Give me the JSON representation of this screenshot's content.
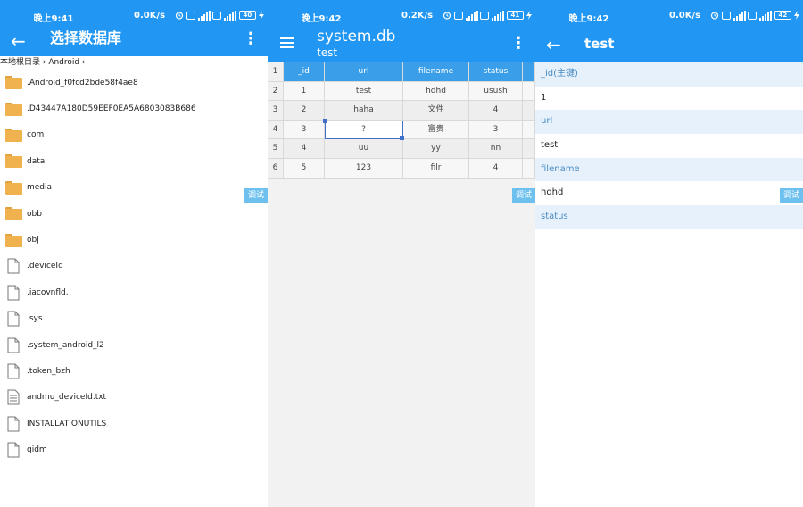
{
  "panels": [
    {
      "status": {
        "time": "晚上9:41",
        "net": "0.0K/s",
        "battery": "40"
      },
      "appbar": {
        "back": "←",
        "title": "选择数据库",
        "menu": "⋮"
      },
      "breadcrumb": "本地根目录 › Android ›",
      "files": [
        {
          "name": ".Android_f0fcd2bde58f4ae8",
          "icon": "folder-icon"
        },
        {
          "name": ".D43447A180D59EEF0EA5A6803083B686",
          "icon": "folder-icon"
        },
        {
          "name": "com",
          "icon": "folder-icon"
        },
        {
          "name": "data",
          "icon": "folder-icon"
        },
        {
          "name": "media",
          "icon": "folder-icon"
        },
        {
          "name": "obb",
          "icon": "folder-icon"
        },
        {
          "name": "obj",
          "icon": "folder-icon"
        },
        {
          "name": ".deviceId",
          "icon": "file-icon"
        },
        {
          "name": ".iacovnfld.",
          "icon": "file-icon"
        },
        {
          "name": ".sys",
          "icon": "file-icon"
        },
        {
          "name": ".system_android_l2",
          "icon": "file-icon"
        },
        {
          "name": ".token_bzh",
          "icon": "file-icon"
        },
        {
          "name": "andmu_deviceId.txt",
          "icon": "text-file-icon"
        },
        {
          "name": "INSTALLATIONUTILS",
          "icon": "file-icon"
        },
        {
          "name": "qidm",
          "icon": "file-icon"
        }
      ],
      "debug": "调试"
    },
    {
      "status": {
        "time": "晚上9:42",
        "net": "0.2K/s",
        "battery": "41"
      },
      "appbar": {
        "title": "system.db",
        "subtitle": "test",
        "menu": "⋮"
      },
      "table": {
        "rownums": [
          "1",
          "2",
          "3",
          "4",
          "5",
          "6"
        ],
        "columns": [
          "_id",
          "url",
          "filename",
          "status"
        ],
        "rows": [
          [
            "1",
            "test",
            "hdhd",
            "usush"
          ],
          [
            "2",
            "haha",
            "文件",
            "4"
          ],
          [
            "3",
            "?",
            "富贵",
            "3"
          ],
          [
            "4",
            "uu",
            "yy",
            "nn"
          ],
          [
            "5",
            "123",
            "filr",
            "4"
          ]
        ]
      },
      "debug": "调试"
    },
    {
      "status": {
        "time": "晚上9:42",
        "net": "0.0K/s",
        "battery": "42"
      },
      "appbar": {
        "back": "←",
        "title": "test"
      },
      "fields": [
        {
          "label": "_id(主键)",
          "value": "1"
        },
        {
          "label": "url",
          "value": "test"
        },
        {
          "label": "filename",
          "value": "hdhd"
        },
        {
          "label": "status",
          "value": ""
        }
      ],
      "debug": "调试"
    }
  ],
  "colors": {
    "primary": "#2196f3",
    "header": "#3a9fe8",
    "folder": "#f0b14f",
    "label_bg": "#e6f1fb",
    "label_text": "#4a8cc4"
  }
}
